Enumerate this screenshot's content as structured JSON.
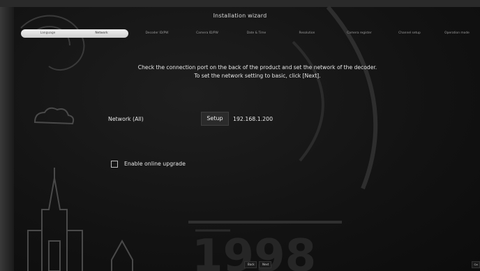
{
  "wizard": {
    "title": "Installation wizard"
  },
  "steps": [
    {
      "label": "Language"
    },
    {
      "label": "Network"
    },
    {
      "label": "Decoder ID/PW"
    },
    {
      "label": "Camera ID/PW"
    },
    {
      "label": "Date & Time"
    },
    {
      "label": "Resolution"
    },
    {
      "label": "Camera register"
    },
    {
      "label": "Channel setup"
    },
    {
      "label": "Operation mode"
    }
  ],
  "instructions": {
    "line1": "Check the connection port on the back of the product and set the network of the decoder.",
    "line2": "To set the network setting to basic, click [Next]."
  },
  "network": {
    "label": "Network (All)",
    "setup_label": "Setup",
    "ip": "192.168.1.200"
  },
  "upgrade": {
    "checked": false,
    "label": "Enable online upgrade"
  },
  "nav": {
    "back_label": "Back",
    "next_label": "Next",
    "corner_label": "Ca"
  },
  "watermark": {
    "year": "1998"
  }
}
